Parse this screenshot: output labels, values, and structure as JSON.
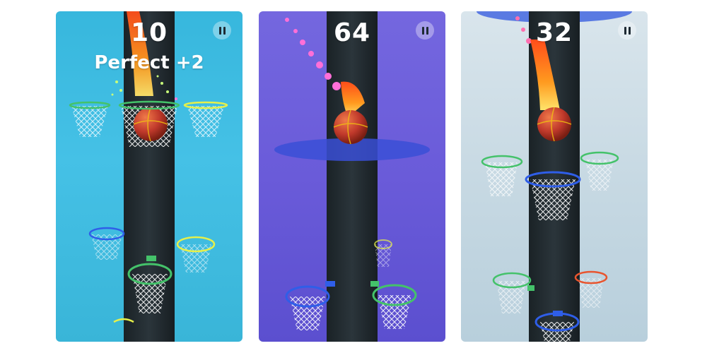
{
  "screens": [
    {
      "theme": "cyan",
      "score": "10",
      "message": "Perfect +2",
      "pause_icon": "pause-icon"
    },
    {
      "theme": "purple",
      "score": "64",
      "pause_icon": "pause-icon"
    },
    {
      "theme": "grey",
      "score": "32",
      "pause_icon": "pause-icon"
    }
  ],
  "colors": {
    "pole": "#252e33",
    "ball": "#c0392b",
    "ball_stripes": "#f1c40f",
    "rim_blue": "#2f5ee8",
    "rim_green": "#44c26a",
    "rim_yellow": "#e6f04a",
    "rim_orange": "#e8552f",
    "flame": "#ff9a1f"
  }
}
